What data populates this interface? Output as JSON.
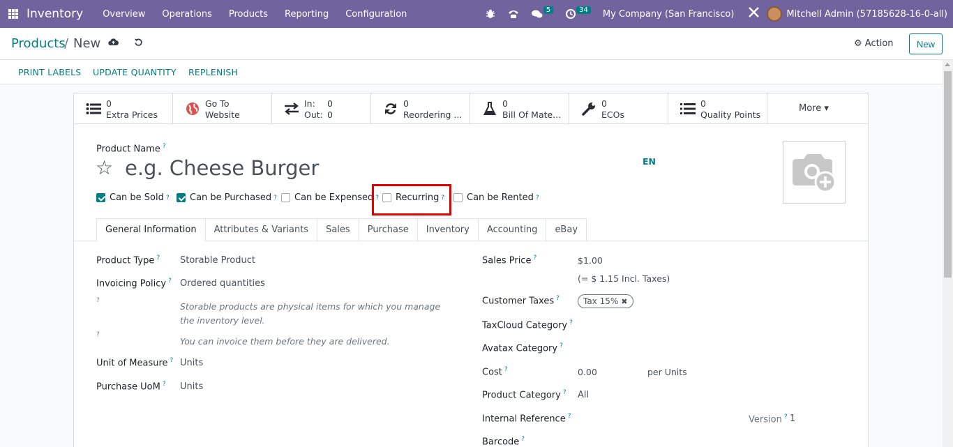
{
  "navbar": {
    "app_name": "Inventory",
    "menu": [
      "Overview",
      "Operations",
      "Products",
      "Reporting",
      "Configuration"
    ],
    "messages_count": "5",
    "activities_count": "34",
    "company": "My Company (San Francisco)",
    "user": "Mitchell Admin (57185628-16-0-all)"
  },
  "breadcrumb": {
    "root": "Products",
    "separator": "/",
    "current": "New"
  },
  "control": {
    "action_label": "Action",
    "new_label": "New"
  },
  "header_buttons": [
    "PRINT LABELS",
    "UPDATE QUANTITY",
    "REPLENISH"
  ],
  "smart_buttons": {
    "extra_prices": {
      "value": "0",
      "label": "Extra Prices"
    },
    "website": {
      "line1": "Go To",
      "line2": "Website"
    },
    "in_out": {
      "in_label": "In:",
      "in_value": "0",
      "out_label": "Out:",
      "out_value": "0"
    },
    "reordering": {
      "value": "0",
      "label": "Reordering ..."
    },
    "bom": {
      "value": "0",
      "label": "Bill Of Mate..."
    },
    "ecos": {
      "value": "0",
      "label": "ECOs"
    },
    "quality": {
      "value": "0",
      "label": "Quality Points"
    },
    "more_label": "More"
  },
  "product": {
    "name_label": "Product Name",
    "name_placeholder": "e.g. Cheese Burger",
    "lang": "EN",
    "help_mark": "?"
  },
  "checkboxes": {
    "can_be_sold": "Can be Sold",
    "can_be_purchased": "Can be Purchased",
    "can_be_expensed": "Can be Expensed",
    "recurring": "Recurring",
    "can_be_rented": "Can be Rented"
  },
  "tabs": [
    "General Information",
    "Attributes & Variants",
    "Sales",
    "Purchase",
    "Inventory",
    "Accounting",
    "eBay"
  ],
  "left_fields": {
    "product_type_label": "Product Type",
    "product_type_value": "Storable Product",
    "invoicing_policy_label": "Invoicing Policy",
    "invoicing_policy_value": "Ordered quantities",
    "help1": "Storable products are physical items for which you manage the inventory level.",
    "help2": "You can invoice them before they are delivered.",
    "uom_label": "Unit of Measure",
    "uom_value": "Units",
    "purchase_uom_label": "Purchase UoM",
    "purchase_uom_value": "Units"
  },
  "right_fields": {
    "sales_price_label": "Sales Price",
    "sales_price_value": "$1.00",
    "incl_taxes": "(= $ 1.15 Incl. Taxes)",
    "customer_taxes_label": "Customer Taxes",
    "tax_tag": "Tax 15%",
    "taxcloud_label": "TaxCloud Category",
    "avatax_label": "Avatax Category",
    "cost_label": "Cost",
    "cost_value": "0.00",
    "per_units": "per Units",
    "category_label": "Product Category",
    "category_value": "All",
    "internal_ref_label": "Internal Reference",
    "version_label": "Version",
    "version_value": "1",
    "barcode_label": "Barcode"
  }
}
